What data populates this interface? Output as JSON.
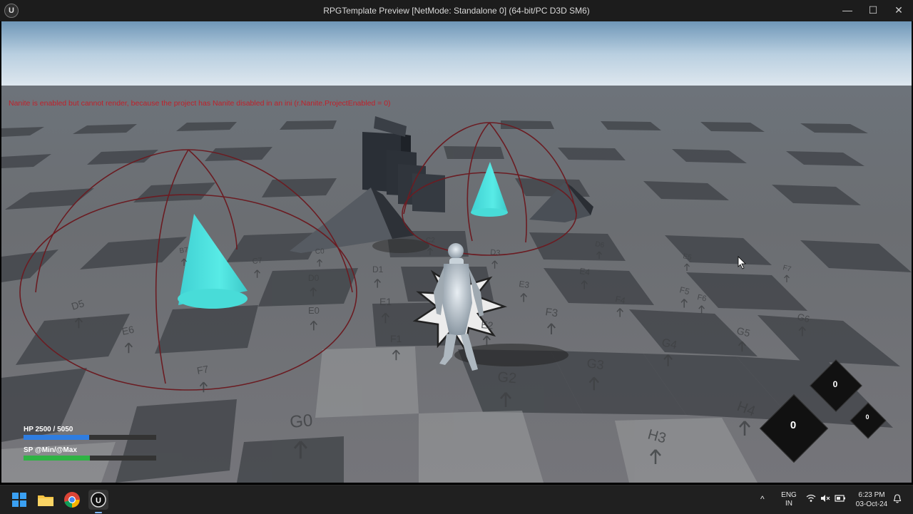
{
  "window": {
    "title": "RPGTemplate Preview [NetMode: Standalone 0]  (64-bit/PC D3D SM6)",
    "minimize_glyph": "—",
    "maximize_glyph": "☐",
    "close_glyph": "✕",
    "logo_glyph": "U"
  },
  "viewport": {
    "warning_text": "Nanite is enabled but cannot render, because the project has Nanite disabled in an ini (r.Nanite.ProjectEnabled = 0)",
    "tile_labels": [
      "D5",
      "E6",
      "F7",
      "G0",
      "G2",
      "G3",
      "G4",
      "G5",
      "G6",
      "H3",
      "H4",
      "E1",
      "F1",
      "E3",
      "F3",
      "F4",
      "F5",
      "E4",
      "D0",
      "D1",
      "C7",
      "E0",
      "E2",
      "D3",
      "D6",
      "E5",
      "F7",
      "B7",
      "C0",
      "C2",
      "F6"
    ],
    "colors": {
      "cone": "#4fe3e0",
      "sphere_lines": "#6b1c22",
      "warning": "#c0202a",
      "sky_top": "#6f97b8"
    }
  },
  "hud": {
    "hp_label": "HP  2500 / 5050",
    "hp_fraction": 0.495,
    "hp_color": "#2f7de0",
    "sp_label": "SP  @Min/@Max",
    "sp_fraction": 0.5,
    "sp_color": "#2fb344",
    "skill_large_value": "0",
    "skill_top_value": "0",
    "skill_small_value": "0"
  },
  "taskbar": {
    "icons": [
      "windows-start-icon",
      "file-explorer-icon",
      "chrome-icon",
      "unreal-engine-icon"
    ],
    "chevron": "^",
    "lang_line1": "ENG",
    "lang_line2": "IN",
    "time": "6:23 PM",
    "date": "03-Oct-24"
  }
}
